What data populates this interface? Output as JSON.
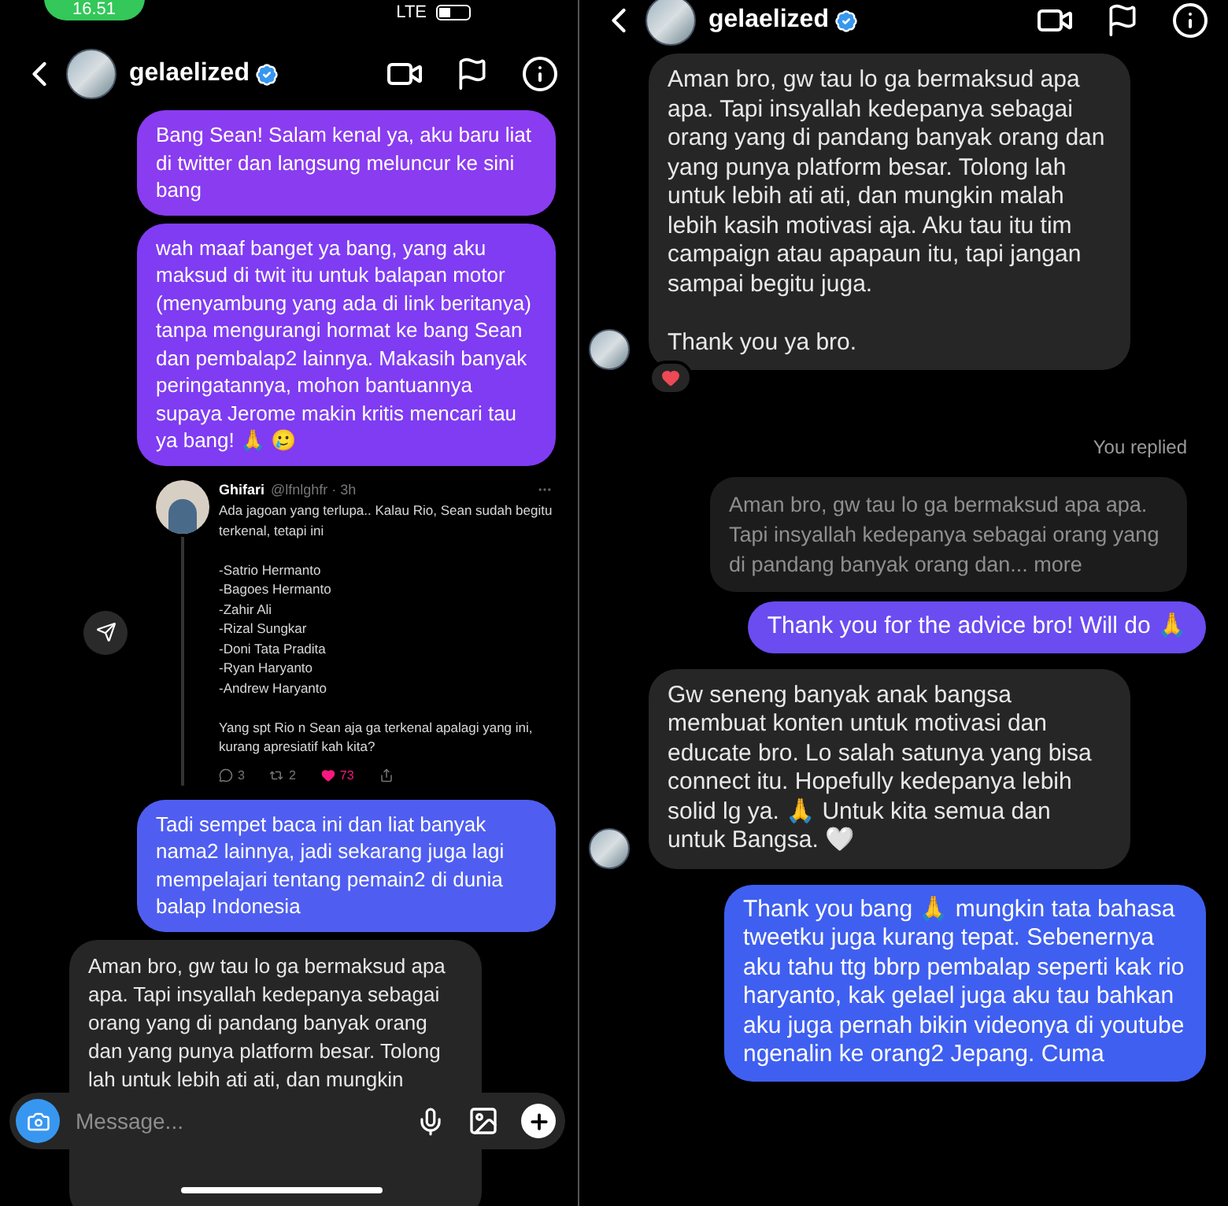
{
  "left_screen": {
    "status_bar": {
      "time": "16.51",
      "network": "LTE"
    },
    "header": {
      "username": "gelaelized",
      "verified": true
    },
    "messages": [
      {
        "kind": "outgoing",
        "color": "#8a3cf0",
        "text": "Bang Sean! Salam kenal ya, aku baru liat di twitter dan langsung meluncur ke sini bang"
      },
      {
        "kind": "outgoing",
        "color": "#7f3cf2",
        "text": "wah maaf banget ya bang, yang aku maksud di twit itu untuk balapan motor (menyambung yang ada di link beritanya) tanpa mengurangi hormat ke bang Sean dan pembalap2 lainnya. Makasih banyak peringatannya, mohon bantuannya supaya Jerome makin kritis mencari tau ya bang! 🙏 🥲"
      },
      {
        "kind": "shared_post",
        "author": "Ghifari",
        "handle": "@lfnlghfr · 3h",
        "text": "Ada jagoan yang terlupa.. Kalau Rio, Sean sudah begitu terkenal, tetapi ini\n\n-Satrio Hermanto\n-Bagoes Hermanto\n-Zahir Ali\n-Rizal Sungkar\n-Doni Tata Pradita\n-Ryan Haryanto\n-Andrew Haryanto\n\nYang spt Rio n Sean aja ga terkenal apalagi yang ini, kurang apresiatif kah kita?",
        "replies": "3",
        "retweets": "2",
        "likes": "73",
        "liked": true
      },
      {
        "kind": "outgoing",
        "color": "#4f5ef0",
        "text": "Tadi sempet baca ini dan liat banyak nama2 lainnya, jadi sekarang juga lagi mempelajari tentang pemain2 di dunia balap Indonesia"
      },
      {
        "kind": "incoming",
        "avatar": false,
        "reacted": false,
        "text": "Aman bro, gw tau lo ga bermaksud apa apa. Tapi insyallah kedepanya sebagai orang yang di pandang banyak orang dan yang punya platform besar. Tolong lah untuk lebih ati ati, dan mungkin"
      }
    ],
    "composer": {
      "placeholder": "Message..."
    }
  },
  "right_screen": {
    "header": {
      "username": "gelaelized",
      "verified": true
    },
    "messages": [
      {
        "kind": "incoming",
        "avatar": true,
        "reacted": true,
        "text": "Aman bro, gw tau lo ga bermaksud apa apa. Tapi insyallah kedepanya sebagai orang yang di pandang banyak orang dan yang punya platform besar. Tolong lah untuk lebih ati ati, dan mungkin malah lebih kasih motivasi aja. Aku tau itu tim campaign atau apapaun itu, tapi jangan sampai begitu juga.\n\nThank you ya bro."
      },
      {
        "kind": "reply_label",
        "text": "You replied"
      },
      {
        "kind": "quoted_reply",
        "text": "Aman bro, gw tau lo ga bermaksud apa apa. Tapi insyallah kedepanya sebagai orang yang di pandang banyak orang dan... more"
      },
      {
        "kind": "outgoing",
        "color": "#6a4cf0",
        "text": "Thank you for the advice bro! Will do 🙏"
      },
      {
        "kind": "incoming",
        "avatar": true,
        "reacted": false,
        "text": "Gw seneng banyak anak bangsa membuat konten untuk motivasi dan educate bro. Lo salah satunya yang bisa connect itu. Hopefully kedepanya lebih solid lg ya. 🙏 Untuk kita semua dan untuk Bangsa. 🤍"
      },
      {
        "kind": "outgoing",
        "color": "#3f5ff0",
        "text": "Thank you bang 🙏 mungkin tata bahasa tweetku juga kurang tepat. Sebenernya aku tahu ttg bbrp pembalap seperti kak rio haryanto, kak gelael juga aku tau bahkan aku juga pernah bikin videonya di youtube ngenalin ke orang2 Jepang. Cuma"
      }
    ]
  }
}
